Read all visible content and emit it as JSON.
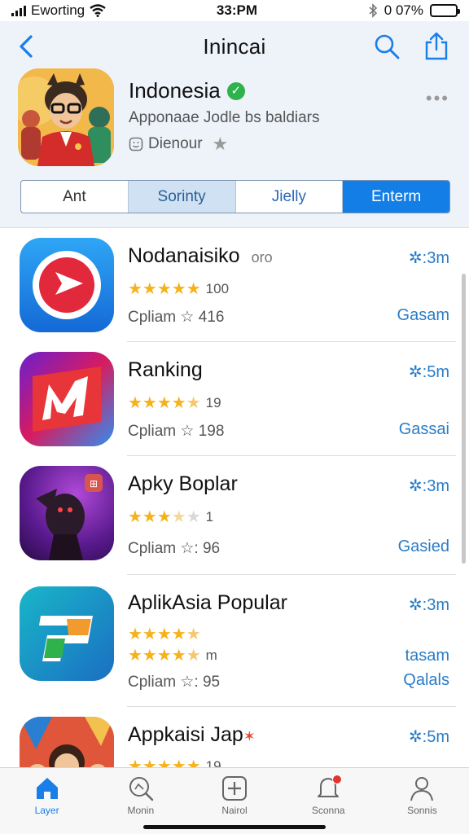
{
  "status_bar": {
    "carrier": "Eworting",
    "time": "33:PM",
    "battery_text": "0 07%"
  },
  "nav": {
    "title": "Inincai"
  },
  "featured": {
    "title": "Indonesia",
    "subtitle": "Apponaae Jodle bs baldiars",
    "meta_label": "Dienour"
  },
  "segments": [
    "Ant",
    "Sorinty",
    "Jielly",
    "Enterm"
  ],
  "apps": [
    {
      "name": "Nodanaisiko",
      "name_extra": "oro",
      "size": "3m",
      "rating_text": "100",
      "category": "Cpliam ☆ 416",
      "action": "Gasam",
      "stars": 5
    },
    {
      "name": "Ranking",
      "name_extra": "",
      "size": "5m",
      "rating_text": "19",
      "category": "Cpliam ☆ 198",
      "action": "Gassai",
      "stars": 4.5
    },
    {
      "name": "Apky Boplar",
      "name_extra": "",
      "size": "3m",
      "rating_text": "1",
      "category": "Cpliam ☆: 96",
      "action": "Gasied",
      "stars": 3.5
    },
    {
      "name": "AplikAsia Popular",
      "name_extra": "",
      "size": "3m",
      "rating_text": "",
      "rating_text_2": "m",
      "category": "Cpliam ☆: 95",
      "action": "Qalals",
      "action_top": "tasam",
      "stars": 4.5
    },
    {
      "name": "Appkaisi Jap",
      "name_extra": "",
      "size": "5m",
      "rating_text": "19",
      "category": "",
      "action": "",
      "stars": 5
    }
  ],
  "tabs": [
    {
      "label": "Layer",
      "icon": "home-icon",
      "active": true
    },
    {
      "label": "Monin",
      "icon": "magnifier-icon",
      "active": false
    },
    {
      "label": "Nairol",
      "icon": "plus-square-icon",
      "active": false
    },
    {
      "label": "Sconna",
      "icon": "bell-icon",
      "active": false
    },
    {
      "label": "Sonnis",
      "icon": "person-icon",
      "active": false
    }
  ],
  "colors": {
    "accent": "#137ee6",
    "star": "#f5b21b",
    "link": "#2a7cc7"
  }
}
